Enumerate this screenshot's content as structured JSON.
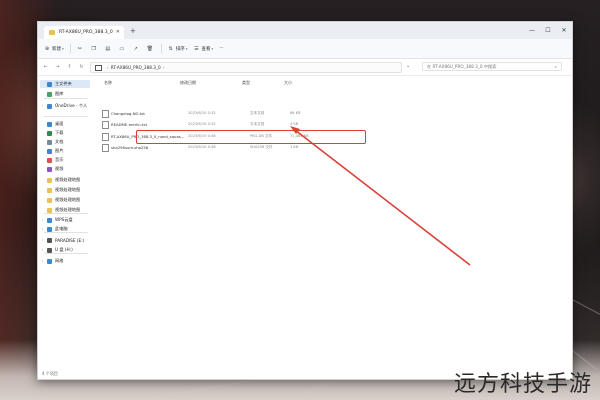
{
  "window": {
    "tab_title": "RT-AX86U_PRO_388.3_0",
    "new_tab": "+",
    "controls": [
      "—",
      "☐",
      "✕"
    ]
  },
  "toolbar": {
    "new_label": "新建",
    "view_label": "查看",
    "more_label": "···",
    "sort_label": "排序",
    "view_label2": "查看"
  },
  "address": {
    "path": "RT-AX86U_PRO_388.3_0",
    "search_placeholder": "在 RT-AX86U_PRO_388.3_0 中搜索"
  },
  "sidebar": {
    "items": [
      {
        "label": "主文件夹",
        "color": "#3d86d7",
        "selected": true
      },
      {
        "label": "图库",
        "color": "#4aa06a"
      },
      {
        "label": "OneDrive - 个人",
        "color": "#3d86d7",
        "expandable": true
      },
      {
        "label": "桌面",
        "color": "#3d86d7"
      },
      {
        "label": "下载",
        "color": "#2f8a4f"
      },
      {
        "label": "文档",
        "color": "#7a8795"
      },
      {
        "label": "图片",
        "color": "#3d86d7"
      },
      {
        "label": "音乐",
        "color": "#d9534f"
      },
      {
        "label": "视频",
        "color": "#8a55c8"
      },
      {
        "label": "视频处理地图",
        "color": "#e8c259"
      },
      {
        "label": "视频处理地图",
        "color": "#e8c259"
      },
      {
        "label": "视频处理地图",
        "color": "#e8c259"
      },
      {
        "label": "视频处理地图",
        "color": "#e8c259"
      },
      {
        "label": "WPS云盘",
        "color": "#3d86d7",
        "expandable": true
      },
      {
        "label": "此电脑",
        "color": "#3d86d7",
        "expandable": true
      },
      {
        "label": "PARADISE (E:)",
        "color": "#555555",
        "expandable": true
      },
      {
        "label": "U 盘 (H:)",
        "color": "#555555",
        "expandable": true
      },
      {
        "label": "网络",
        "color": "#3d86d7",
        "expandable": true
      }
    ]
  },
  "columns": {
    "name": "名称",
    "date": "修改日期",
    "type": "类型",
    "size": "大小"
  },
  "files": [
    {
      "name": "Changelog-NG.txt",
      "date": "2023/6/10 0:32",
      "type": "文本文档",
      "size": "66 KB"
    },
    {
      "name": "README-merlin.txt",
      "date": "2023/6/10 0:32",
      "type": "文本文档",
      "size": "4 KB"
    },
    {
      "name": "RT-AX86U_PRO_388.3_0_nand_squas...",
      "date": "2023/6/10 0:48",
      "type": "PKG-DB 文件",
      "size": "71,481 KB"
    },
    {
      "name": "sha256sum.sha256",
      "date": "2023/6/10 0:48",
      "type": "SHA256 文件",
      "size": "1 KB"
    }
  ],
  "status": {
    "count": "4 个项目"
  },
  "watermark": "远方科技手游",
  "colors": {
    "highlight": "#e23a34",
    "accent": "#3d86d7"
  }
}
